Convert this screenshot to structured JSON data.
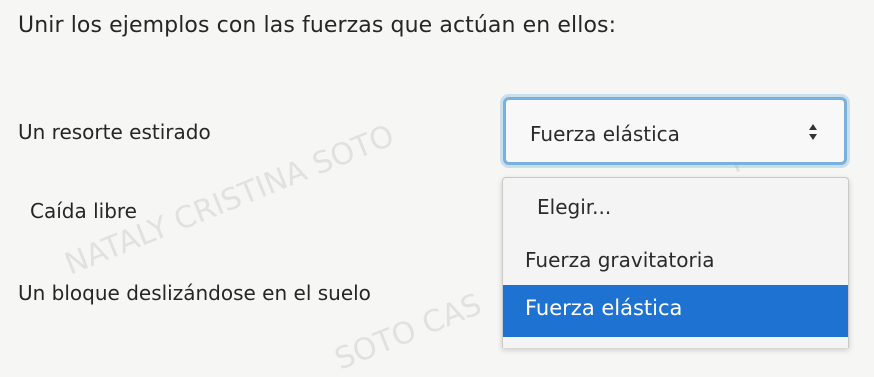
{
  "question": {
    "title": "Unir los ejemplos con las fuerzas que actúan en ellos:",
    "watermark": "NATALY CRISTINA SOTO CASTRO"
  },
  "pairs": [
    {
      "prompt": "Un resorte estirado"
    },
    {
      "prompt": "Caída libre"
    },
    {
      "prompt": "Un bloque deslizándose en el suelo"
    }
  ],
  "select": {
    "value": "Fuerza elástica",
    "icon": "updown-arrows-icon",
    "accent": "#78b1dd"
  },
  "dropdown": {
    "options": [
      {
        "label": "Elegir..."
      },
      {
        "label": "Fuerza gravitatoria"
      },
      {
        "label": "Fuerza elástica",
        "highlighted": true
      }
    ],
    "highlight_color": "#1e73d2"
  }
}
